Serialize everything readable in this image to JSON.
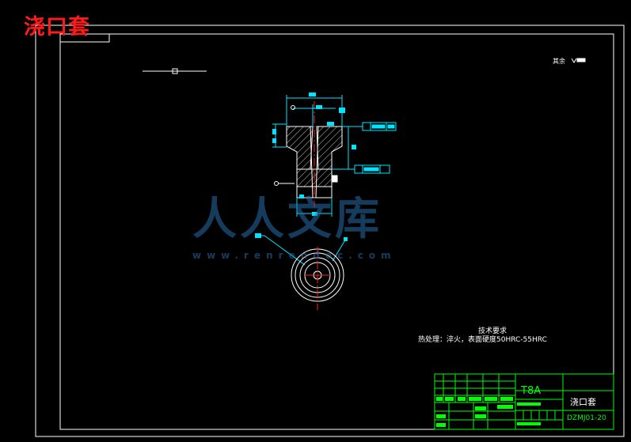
{
  "overlay_title": "浇口套",
  "drawing": {
    "surface_note": "其余",
    "tech_req_title": "技术要求",
    "tech_req_line": "热处理：淬火，表面硬度50HRC-55HRC"
  },
  "title_block": {
    "material": "T8A",
    "part_name": "浇口套",
    "drawing_number": "DZMJ01-20"
  },
  "watermark": {
    "text": "人人文库",
    "url": "www.renrendoc.com"
  },
  "colors": {
    "background": "#000000",
    "outline": "#ffffff",
    "dimension": "#00e5ff",
    "titleblock": "#00ff00",
    "centerline": "#ff2020",
    "overlay": "#ff1a1a"
  }
}
